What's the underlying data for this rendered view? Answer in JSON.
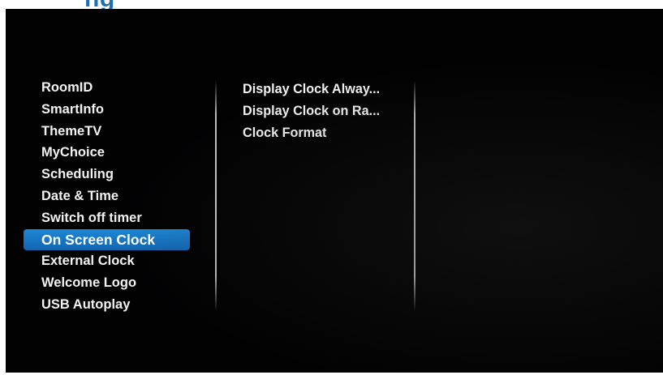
{
  "header": {
    "partial_title": "ng"
  },
  "left_menu": {
    "items": [
      {
        "label": "RoomID"
      },
      {
        "label": "SmartInfo"
      },
      {
        "label": "ThemeTV"
      },
      {
        "label": "MyChoice"
      },
      {
        "label": "Scheduling"
      },
      {
        "label": "Date & Time"
      },
      {
        "label": "Switch off timer"
      },
      {
        "label": "On Screen Clock",
        "selected": true
      },
      {
        "label": "External Clock"
      },
      {
        "label": "Welcome Logo"
      },
      {
        "label": "USB Autoplay"
      }
    ]
  },
  "sub_menu": {
    "items": [
      {
        "label": "Display Clock Alway..."
      },
      {
        "label": "Display Clock on Ra..."
      },
      {
        "label": "Clock Format"
      }
    ]
  },
  "colors": {
    "screen_background": "#020203",
    "selection_highlight": "#1a7bc7",
    "menu_text": "#f2f2f2",
    "heading_blue": "#1f6fb5"
  }
}
